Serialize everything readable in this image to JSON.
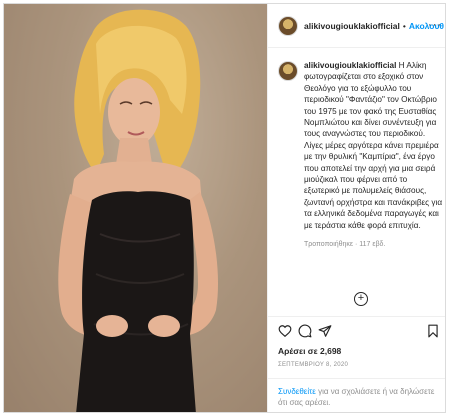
{
  "post": {
    "username": "alikivougiouklakiofficial",
    "separator": "•",
    "follow_label": "Ακολουθ",
    "more_options": "···"
  },
  "caption": {
    "username": "alikivougiouklakiofficial",
    "text": "Η Αλίκη φωτογραφίζεται στο εξοχικό στον Θεολόγο για το εξώφυλλο του περιοδικού \"Φαντάζιο\" τον Οκτώβριο του 1975 με τον φακό της Ευσταθίας Νομπλιώτου και δίνει συνέντευξη για τους αναγνώστες του περιοδικού. Λίγες μέρες αργότερα κάνει πρεμιέρα με την θρυλική \"Καμπίρια\", ένα έργο που αποτελεί την αρχή για μια σειρά μιούζικαλ που φέρνει από το εξωτερικό με πολυμελείς θιάσους, ζωντανή ορχήστρα και πανάκριβες για τα ελληνικά δεδομένα παραγωγές και με τεράστια κάθε φορά επιτυχία.",
    "meta": "Τροποποιήθηκε · 117 εβδ."
  },
  "load_more": "+",
  "icons": {
    "like": "heart-icon",
    "comment": "comment-icon",
    "share": "paper-plane-icon",
    "save": "bookmark-icon"
  },
  "likes_text": "Αρέσει σε 2,698",
  "date_text": "ΣΕΠΤΕΜΒΡΙΟΥ 8, 2020",
  "login_prompt": {
    "link_text": "Συνδεθείτε",
    "rest_text": " για να σχολιάσετε ή να δηλώσετε ότι σας αρέσει."
  },
  "colors": {
    "link_blue": "#0095f6",
    "text": "#262626",
    "muted": "#8e8e8e",
    "border": "#dbdbdb"
  }
}
